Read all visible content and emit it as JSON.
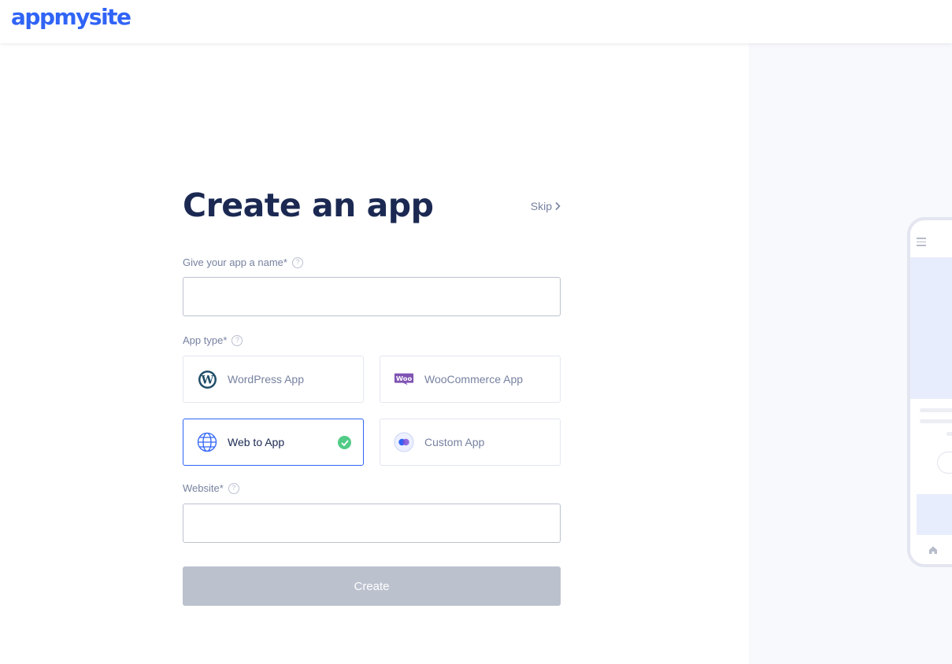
{
  "header": {
    "logo_text": "appmysite",
    "brand_color": "#3064f6"
  },
  "form": {
    "title": "Create an app",
    "skip_label": "Skip",
    "app_name": {
      "label": "Give your app a name*",
      "value": "",
      "placeholder": ""
    },
    "app_type": {
      "label": "App type*",
      "options": [
        {
          "label": "WordPress App",
          "icon": "wordpress-icon",
          "selected": false
        },
        {
          "label": "WooCommerce App",
          "icon": "woocommerce-icon",
          "selected": false
        },
        {
          "label": "Web to App",
          "icon": "globe-icon",
          "selected": true
        },
        {
          "label": "Custom App",
          "icon": "custom-app-icon",
          "selected": false
        }
      ]
    },
    "website": {
      "label": "Website*",
      "value": "",
      "placeholder": ""
    },
    "create_label": "Create"
  },
  "colors": {
    "text_dark": "#1b2952",
    "text_muted": "#7782a1",
    "border": "#bcc1ce",
    "selected_border": "#3064f6",
    "check_green": "#52cb86",
    "button_disabled": "#bcc1ce",
    "panel_bg": "#f8f9fd"
  }
}
